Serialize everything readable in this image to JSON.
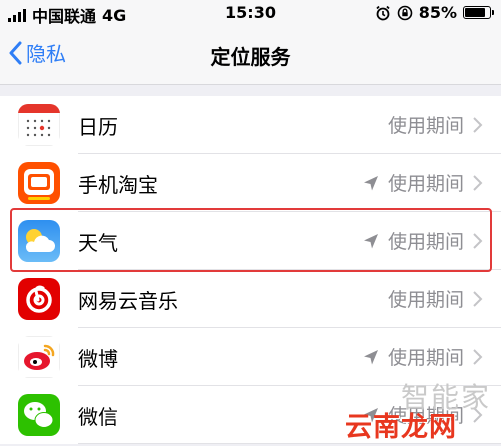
{
  "status_bar": {
    "carrier": "中国联通",
    "network": "4G",
    "time": "15:30",
    "battery_percent": "85%",
    "battery_level": 0.85
  },
  "nav": {
    "back_label": "隐私",
    "title": "定位服务"
  },
  "apps": [
    {
      "name": "日历",
      "status": "使用期间",
      "location_arrow": false,
      "icon": "calendar-icon"
    },
    {
      "name": "手机淘宝",
      "status": "使用期间",
      "location_arrow": true,
      "icon": "taobao-icon"
    },
    {
      "name": "天气",
      "status": "使用期间",
      "location_arrow": true,
      "icon": "weather-icon",
      "highlighted": true
    },
    {
      "name": "网易云音乐",
      "status": "使用期间",
      "location_arrow": false,
      "icon": "netease-music-icon"
    },
    {
      "name": "微博",
      "status": "使用期间",
      "location_arrow": true,
      "icon": "weibo-icon"
    },
    {
      "name": "微信",
      "status": "使用期间",
      "location_arrow": true,
      "icon": "wechat-icon"
    }
  ],
  "watermark": {
    "back_text": "智能家",
    "front_text": "云南龙网"
  },
  "colors": {
    "accent": "#2f7ef6",
    "highlight": "#e23a3a",
    "secondary_text": "#8e8e93"
  }
}
